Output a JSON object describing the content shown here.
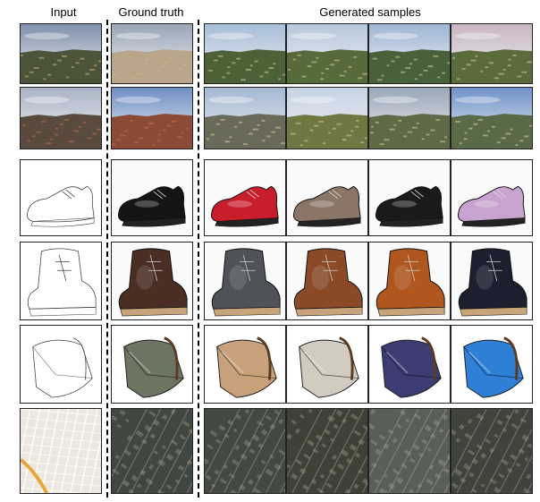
{
  "headers": {
    "input": "Input",
    "ground_truth": "Ground truth",
    "generated": "Generated samples"
  },
  "rows": [
    {
      "kind": "landscape-sunset",
      "sky": "#7f90aa",
      "land": "#4b5438",
      "accent": "#d6b27a",
      "gt": {
        "sky": "#9aa6b7",
        "land": "#b9a58a"
      },
      "samples": [
        {
          "sky": "#a7bdd9",
          "land": "#4d6136"
        },
        {
          "sky": "#b7c7dc",
          "land": "#566a3b"
        },
        {
          "sky": "#9fb7d6",
          "land": "#48613a"
        },
        {
          "sky": "#c8b6c2",
          "land": "#5a6b3c"
        }
      ]
    },
    {
      "kind": "landscape-village",
      "sky": "#aab4c6",
      "land": "#5a4a3e",
      "accent": "#c46b4a",
      "gt": {
        "sky": "#6e8fc4",
        "land": "#8a4a35"
      },
      "samples": [
        {
          "sky": "#a4b8d4",
          "land": "#6a6a5a"
        },
        {
          "sky": "#c6d3e4",
          "land": "#6f7743"
        },
        {
          "sky": "#9aa7b8",
          "land": "#5d6a45"
        },
        {
          "sky": "#6f92c8",
          "land": "#596b46"
        }
      ]
    },
    {
      "kind": "shoe",
      "gt": "#151515",
      "samples": [
        "#c81e2b",
        "#8a7566",
        "#1a1a1a",
        "#c9a3cf"
      ]
    },
    {
      "kind": "boot",
      "gt": "#4a2e24",
      "samples": [
        "#4f5259",
        "#8a4a28",
        "#b0561f",
        "#1e1f2e"
      ]
    },
    {
      "kind": "bag",
      "gt": "#6d7462",
      "samples": [
        "#c8a07a",
        "#d4cbc0",
        "#3b3d72",
        "#2f7fd6"
      ]
    },
    {
      "kind": "map",
      "map_bg": "#ede8df",
      "road": "#e6a63a",
      "gt": "#404740",
      "samples": [
        "#434842",
        "#3e4236",
        "#5a5e58",
        "#3f433c"
      ]
    }
  ]
}
